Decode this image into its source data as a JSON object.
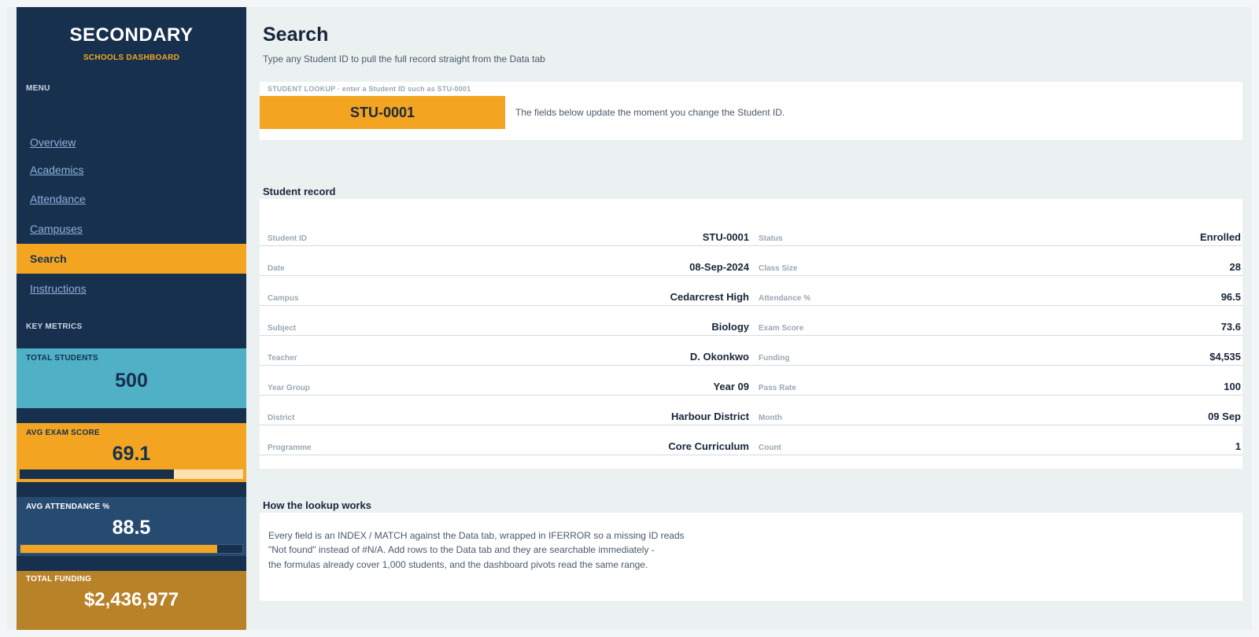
{
  "sidebar": {
    "brand_title": "SECONDARY",
    "brand_subtitle": "SCHOOLS DASHBOARD",
    "menu_label": "MENU",
    "nav": [
      {
        "label": "Overview"
      },
      {
        "label": "Academics"
      },
      {
        "label": "Attendance"
      },
      {
        "label": "Campuses"
      },
      {
        "label": "Search",
        "active": true
      },
      {
        "label": "Instructions"
      }
    ],
    "metrics_label": "KEY METRICS",
    "metrics": {
      "total_students": {
        "label": "TOTAL STUDENTS",
        "value": "500",
        "color": "#4fb0c6"
      },
      "avg_exam_score": {
        "label": "AVG EXAM SCORE",
        "value": "69.1",
        "progress": 0.691,
        "color": "#f3a521"
      },
      "avg_attendance": {
        "label": "AVG ATTENDANCE %",
        "value": "88.5",
        "progress": 0.885,
        "color": "#264a70"
      },
      "total_funding": {
        "label": "TOTAL FUNDING",
        "value": "$2,436,977",
        "color": "#b88229"
      }
    }
  },
  "main": {
    "title": "Search",
    "subtitle": "Type any Student ID to pull the full record straight from the Data tab",
    "lookup": {
      "caption": "STUDENT LOOKUP  ·  enter a Student ID such as STU-0001",
      "value": "STU-0001",
      "note": "The fields below update the moment you change the Student ID."
    },
    "record_title": "Student record",
    "record": {
      "left": [
        {
          "label": "Student ID",
          "value": "STU-0001"
        },
        {
          "label": "Date",
          "value": "08-Sep-2024"
        },
        {
          "label": "Campus",
          "value": "Cedarcrest High"
        },
        {
          "label": "Subject",
          "value": "Biology"
        },
        {
          "label": "Teacher",
          "value": "D. Okonkwo"
        },
        {
          "label": "Year Group",
          "value": "Year 09"
        },
        {
          "label": "District",
          "value": "Harbour District"
        },
        {
          "label": "Programme",
          "value": "Core Curriculum"
        }
      ],
      "right": [
        {
          "label": "Status",
          "value": "Enrolled"
        },
        {
          "label": "Class Size",
          "value": "28"
        },
        {
          "label": "Attendance %",
          "value": "96.5"
        },
        {
          "label": "Exam Score",
          "value": "73.6"
        },
        {
          "label": "Funding",
          "value": "$4,535"
        },
        {
          "label": "Pass Rate",
          "value": "100"
        },
        {
          "label": "Month",
          "value": "09 Sep"
        },
        {
          "label": "Count",
          "value": "1"
        }
      ]
    },
    "how_title": "How the lookup works",
    "how_lines": [
      "Every field is an INDEX / MATCH against the Data tab, wrapped in IFERROR so a missing ID reads",
      "\"Not found\" instead of #N/A. Add rows to the Data tab and they are searchable immediately -",
      "the formulas already cover 1,000 students, and the dashboard pivots read the same range."
    ]
  }
}
